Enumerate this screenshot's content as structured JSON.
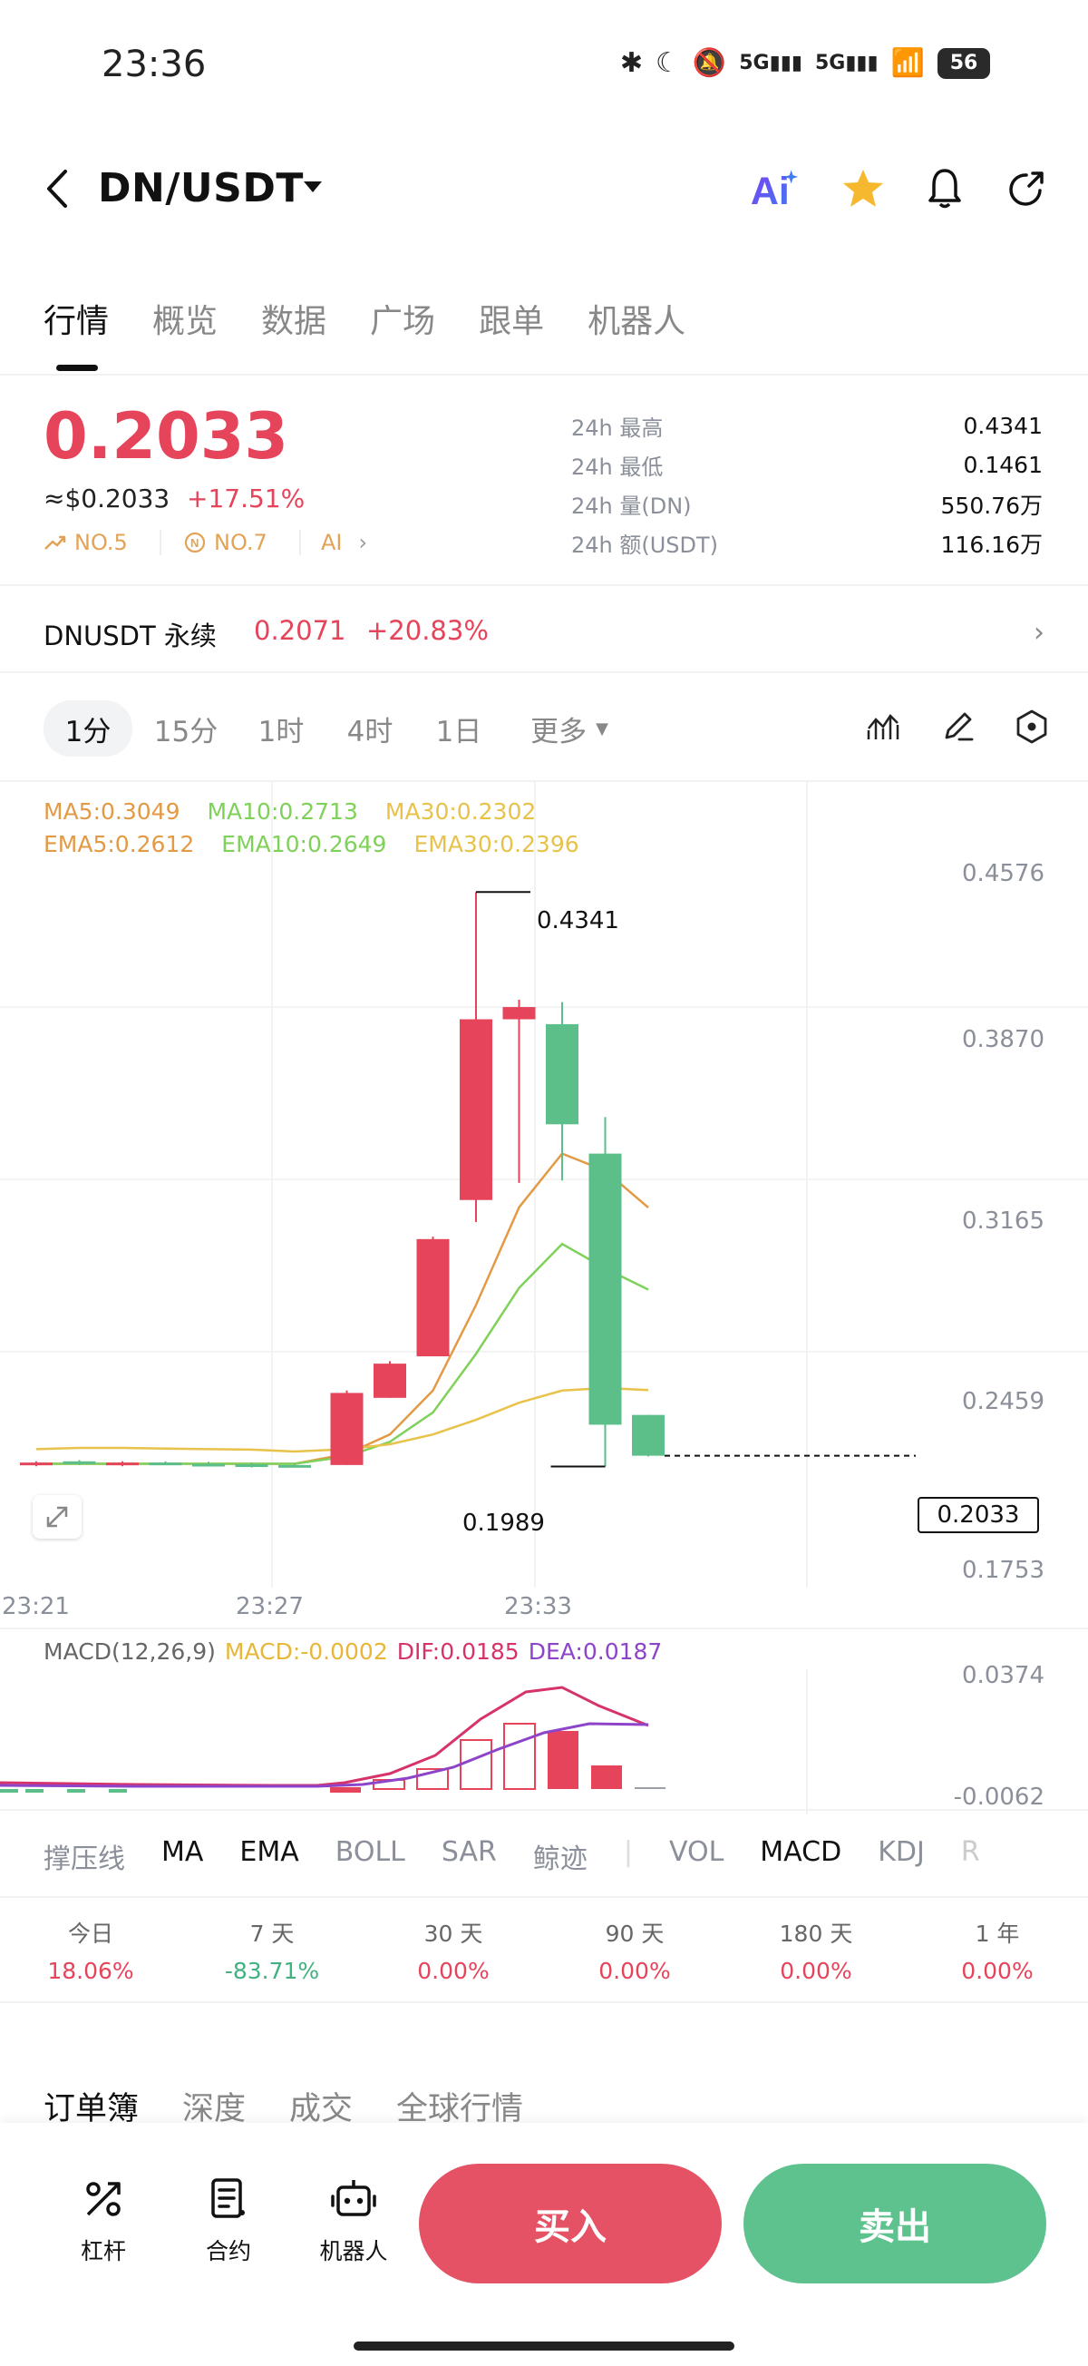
{
  "status_bar": {
    "time": "23:36",
    "net1": "5G",
    "net2": "5G",
    "battery": "56"
  },
  "header": {
    "pair": "DN/USDT"
  },
  "tabs": [
    "行情",
    "概览",
    "数据",
    "广场",
    "跟单",
    "机器人"
  ],
  "price": {
    "last": "0.2033",
    "usd": "≈$0.2033",
    "change": "+17.51%",
    "rank1": "NO.5",
    "rank2": "NO.7",
    "ai": "AI"
  },
  "stats": [
    {
      "label": "24h  最高",
      "value": "0.4341"
    },
    {
      "label": "24h  最低",
      "value": "0.1461"
    },
    {
      "label": "24h  量(DN)",
      "value": "550.76万"
    },
    {
      "label": "24h  额(USDT)",
      "value": "116.16万"
    }
  ],
  "perpetual": {
    "label": "DNUSDT 永续",
    "price": "0.2071",
    "change": "+20.83%"
  },
  "intervals": [
    "1分",
    "15分",
    "1时",
    "4时",
    "1日",
    "更多"
  ],
  "ma": {
    "ma5": "MA5:0.3049",
    "ma10": "MA10:0.2713",
    "ma30": "MA30:0.2302",
    "ema5": "EMA5:0.2612",
    "ema10": "EMA10:0.2649",
    "ema30": "EMA30:0.2396",
    "color_ma5": "#e39a45",
    "color_ma10": "#7fd15a",
    "color_ma30": "#e8c24a"
  },
  "chart_data": {
    "type": "candlestick",
    "y_axis_ticks": [
      "0.4576",
      "0.3870",
      "0.3165",
      "0.2459",
      "0.1753"
    ],
    "x_axis_ticks": [
      "23:21",
      "23:27",
      "23:33"
    ],
    "high_label": "0.4341",
    "low_label": "0.1989",
    "last_label": "0.2033",
    "ylim": [
      0.1753,
      0.4576
    ],
    "candles": [
      {
        "o": 0.2,
        "h": 0.201,
        "l": 0.199,
        "c": 0.2005
      },
      {
        "o": 0.201,
        "h": 0.2015,
        "l": 0.1995,
        "c": 0.2
      },
      {
        "o": 0.2,
        "h": 0.201,
        "l": 0.199,
        "c": 0.2005
      },
      {
        "o": 0.2005,
        "h": 0.201,
        "l": 0.1995,
        "c": 0.2
      },
      {
        "o": 0.2,
        "h": 0.2008,
        "l": 0.1994,
        "c": 0.1998
      },
      {
        "o": 0.1998,
        "h": 0.2005,
        "l": 0.1985,
        "c": 0.1995
      },
      {
        "o": 0.1995,
        "h": 0.2,
        "l": 0.1985,
        "c": 0.199
      },
      {
        "o": 0.1995,
        "h": 0.23,
        "l": 0.1995,
        "c": 0.229
      },
      {
        "o": 0.227,
        "h": 0.242,
        "l": 0.227,
        "c": 0.241
      },
      {
        "o": 0.244,
        "h": 0.293,
        "l": 0.244,
        "c": 0.292
      },
      {
        "o": 0.308,
        "h": 0.4341,
        "l": 0.299,
        "c": 0.382
      },
      {
        "o": 0.382,
        "h": 0.39,
        "l": 0.315,
        "c": 0.387
      },
      {
        "o": 0.38,
        "h": 0.389,
        "l": 0.316,
        "c": 0.339
      },
      {
        "o": 0.327,
        "h": 0.342,
        "l": 0.1989,
        "c": 0.216
      },
      {
        "o": 0.22,
        "h": 0.22,
        "l": 0.203,
        "c": 0.2033
      }
    ],
    "ma_lines": {
      "ma5": [
        0.2,
        0.2,
        0.2,
        0.2,
        0.2,
        0.2,
        0.2,
        0.204,
        0.212,
        0.23,
        0.265,
        0.305,
        0.327,
        0.32,
        0.3049
      ],
      "ma10": [
        0.2,
        0.2,
        0.2,
        0.2,
        0.2,
        0.2,
        0.2,
        0.203,
        0.209,
        0.221,
        0.245,
        0.272,
        0.29,
        0.28,
        0.2713
      ],
      "ma30": [
        0.206,
        0.2065,
        0.2065,
        0.2062,
        0.206,
        0.2058,
        0.205,
        0.206,
        0.208,
        0.212,
        0.218,
        0.225,
        0.23,
        0.231,
        0.2302
      ]
    },
    "macd": {
      "label": "MACD(12,26,9)",
      "macd": "MACD:-0.0002",
      "dif": "DIF:0.0185",
      "dea": "DEA:0.0187",
      "y_ticks": [
        "0.0374",
        "-0.0062"
      ]
    }
  },
  "indicators": [
    "撑压线",
    "MA",
    "EMA",
    "BOLL",
    "SAR",
    "鲸迹",
    "VOL",
    "MACD",
    "KDJ",
    "R"
  ],
  "performance": [
    {
      "label": "今日",
      "value": "18.06%"
    },
    {
      "label": "7 天",
      "value": "-83.71%"
    },
    {
      "label": "30 天",
      "value": "0.00%"
    },
    {
      "label": "90 天",
      "value": "0.00%"
    },
    {
      "label": "180 天",
      "value": "0.00%"
    },
    {
      "label": "1 年",
      "value": "0.00%"
    }
  ],
  "orderbook_tabs": [
    "订单簿",
    "深度",
    "成交",
    "全球行情"
  ],
  "bottom": {
    "leverage": "杠杆",
    "contract": "合约",
    "bot": "机器人",
    "buy": "买入",
    "sell": "卖出"
  }
}
